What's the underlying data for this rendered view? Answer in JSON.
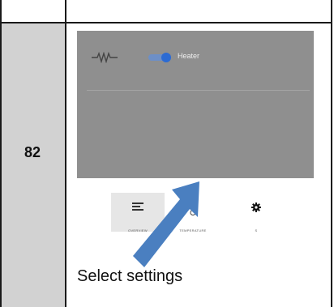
{
  "step": {
    "number": "82"
  },
  "caption": "Select settings",
  "screen": {
    "toggle": {
      "label": "Heater",
      "state": "on"
    },
    "nav": {
      "items": [
        {
          "label": "OVERVIEW",
          "icon": "overview-icon",
          "active": true
        },
        {
          "label": "TEMPERATURE",
          "icon": "thermometer-icon",
          "active": false
        },
        {
          "label": "S",
          "icon": "settings-gear-icon",
          "active": false
        }
      ]
    }
  },
  "colors": {
    "screen_bg": "#8f8f8f",
    "toggle_accent": "#2c6bd3",
    "arrow": "#4a7fc0",
    "number_cell": "#d2d2d2"
  }
}
